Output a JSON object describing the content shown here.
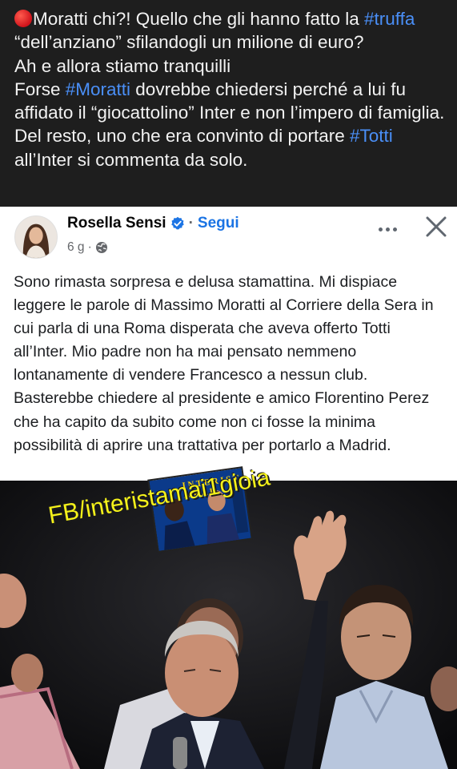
{
  "caption": {
    "line1_prefix": "Moratti chi?! Quello che gli hanno fatto la ",
    "tag_truffa": "#truffa",
    "line1_suffix": " “dell’anziano” sfilandogli un milione di euro?",
    "line2": "Ah e allora stiamo tranquilli",
    "line3_prefix": "Forse ",
    "tag_moratti": "#Moratti",
    "line3_middle": " dovrebbe chiedersi perché a lui fu affidato il “giocattolino” Inter e non l’impero di famiglia. Del resto, uno che era convinto di portare ",
    "tag_totti": "#Totti",
    "line3_suffix": " all’Inter si commenta da solo.",
    "colors": {
      "background": "#1e1e1e",
      "text": "#f2f2f2",
      "hashtag": "#4a8ff7",
      "dot": "#d0131b"
    }
  },
  "post": {
    "author": "Rosella Sensi",
    "separator": "·",
    "follow_label": "Segui",
    "time": "6 g",
    "time_separator": "·",
    "privacy_icon": "globe-icon",
    "more_icon": "more-horizontal-icon",
    "close_icon": "close-icon",
    "verified_icon": "verified-badge-icon",
    "body": "Sono rimasta sorpresa e delusa stamattina. Mi dispiace leggere le parole di Massimo Moratti al Corriere della Sera in cui parla di una Roma disperata che aveva offerto Totti all’Inter. Mio padre non ha mai pensato nemmeno lontanamente di vendere Francesco a nessun club. Basterebbe chiedere al presidente e amico Florentino Perez che ha capito da subito come non ci fosse la minima possibilità di aprire una trattativa per portarlo a Madrid.",
    "colors": {
      "accent": "#1b74e4",
      "text": "#1c1e21",
      "muted": "#65676b"
    }
  },
  "photo": {
    "watermark": "FB/interistamai1gioia",
    "sticker_letters": "I N T E R I S T A M A I",
    "watermark_color": "#f4f11a"
  }
}
